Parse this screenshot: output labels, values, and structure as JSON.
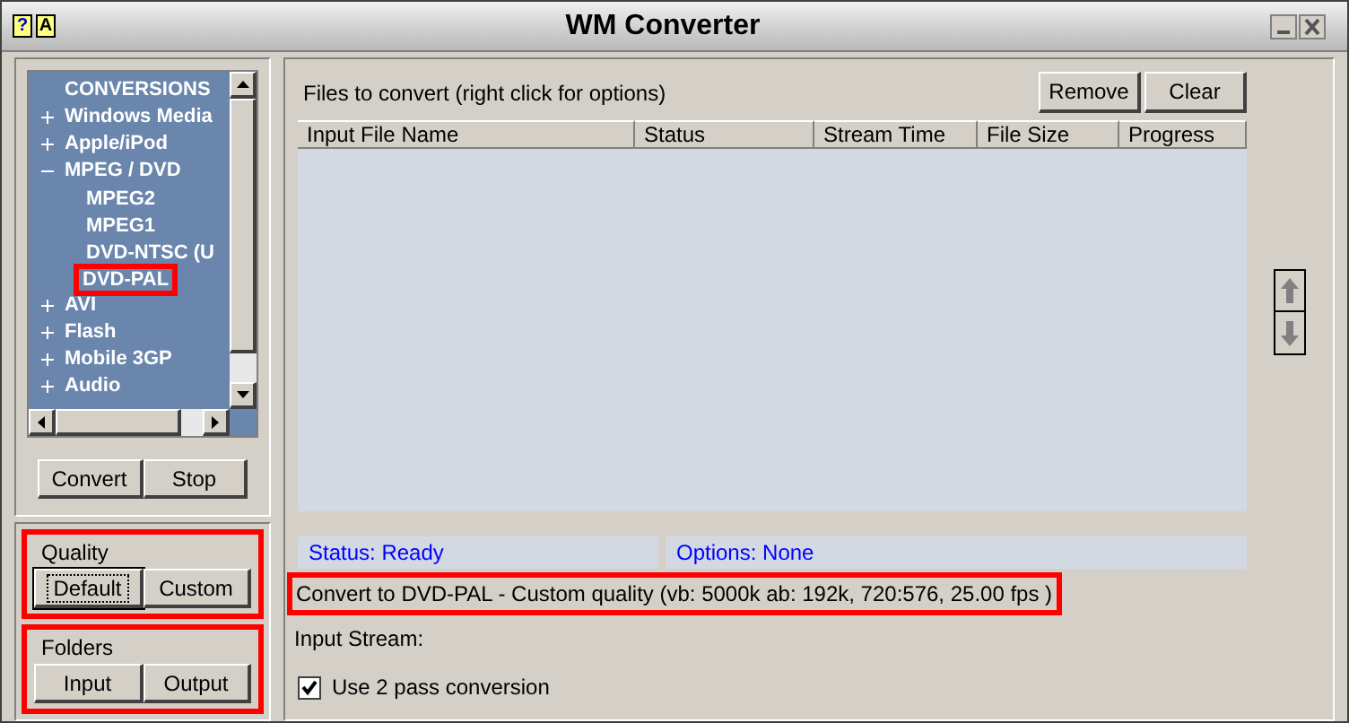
{
  "window": {
    "title": "WM Converter",
    "help_button": "?",
    "font_button": "A"
  },
  "tree": [
    {
      "label": "CONVERSIONS",
      "kind": "root"
    },
    {
      "label": "Windows Media",
      "kind": "group",
      "expanded": false
    },
    {
      "label": "Apple/iPod",
      "kind": "group",
      "expanded": false
    },
    {
      "label": "MPEG / DVD",
      "kind": "group",
      "expanded": true,
      "children": [
        {
          "label": "MPEG2",
          "highlighted": false
        },
        {
          "label": "MPEG1",
          "highlighted": false
        },
        {
          "label": "DVD-NTSC (U",
          "highlighted": false
        },
        {
          "label": "DVD-PAL",
          "highlighted": true
        }
      ]
    },
    {
      "label": "AVI",
      "kind": "group",
      "expanded": false
    },
    {
      "label": "Flash",
      "kind": "group",
      "expanded": false
    },
    {
      "label": "Mobile 3GP",
      "kind": "group",
      "expanded": false
    },
    {
      "label": "Audio",
      "kind": "group",
      "expanded": false
    }
  ],
  "left_buttons": [
    "Convert",
    "Stop"
  ],
  "quality": {
    "title": "Quality",
    "buttons": [
      {
        "label": "Default",
        "focused": true
      },
      {
        "label": "Custom",
        "focused": false
      }
    ]
  },
  "folders": {
    "title": "Folders",
    "buttons": [
      {
        "label": "Input",
        "focused": false
      },
      {
        "label": "Output",
        "focused": false
      }
    ]
  },
  "files": {
    "label": "Files to convert (right click for options)",
    "buttons": [
      "Remove",
      "Clear"
    ],
    "columns": [
      "Input File Name",
      "Status",
      "Stream Time",
      "File Size",
      "Progress"
    ]
  },
  "status": {
    "status": "Status: Ready",
    "options": "Options: None"
  },
  "convert_summary": "Convert to DVD-PAL - Custom quality (vb: 5000k ab: 192k, 720:576, 25.00 fps )",
  "input_stream": "Input Stream:",
  "two_pass": {
    "label": "Use 2 pass conversion",
    "checked": true
  }
}
